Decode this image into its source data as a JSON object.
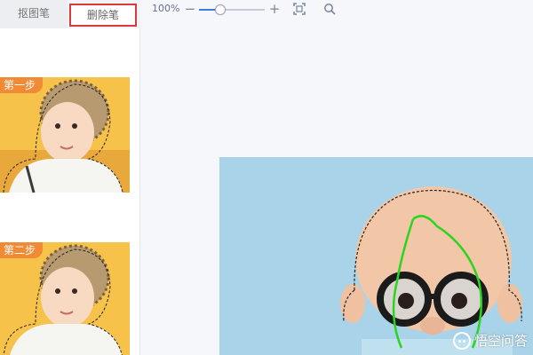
{
  "tabs": {
    "cutout_label": "抠图笔",
    "erase_label": "删除笔"
  },
  "steps": [
    {
      "label": "第一步"
    },
    {
      "label": "第二步"
    }
  ],
  "toolbar": {
    "zoom_level": "100%",
    "zoom_fraction": 0.33,
    "zoom_out_glyph": "−",
    "zoom_in_glyph": "+"
  },
  "watermark": {
    "text": "悟空问答"
  },
  "colors": {
    "highlight_border": "#d93a3a",
    "canvas_background": "#a8d3e8",
    "selection_stroke": "#2bd41e",
    "step_badge": "#f08a35"
  }
}
